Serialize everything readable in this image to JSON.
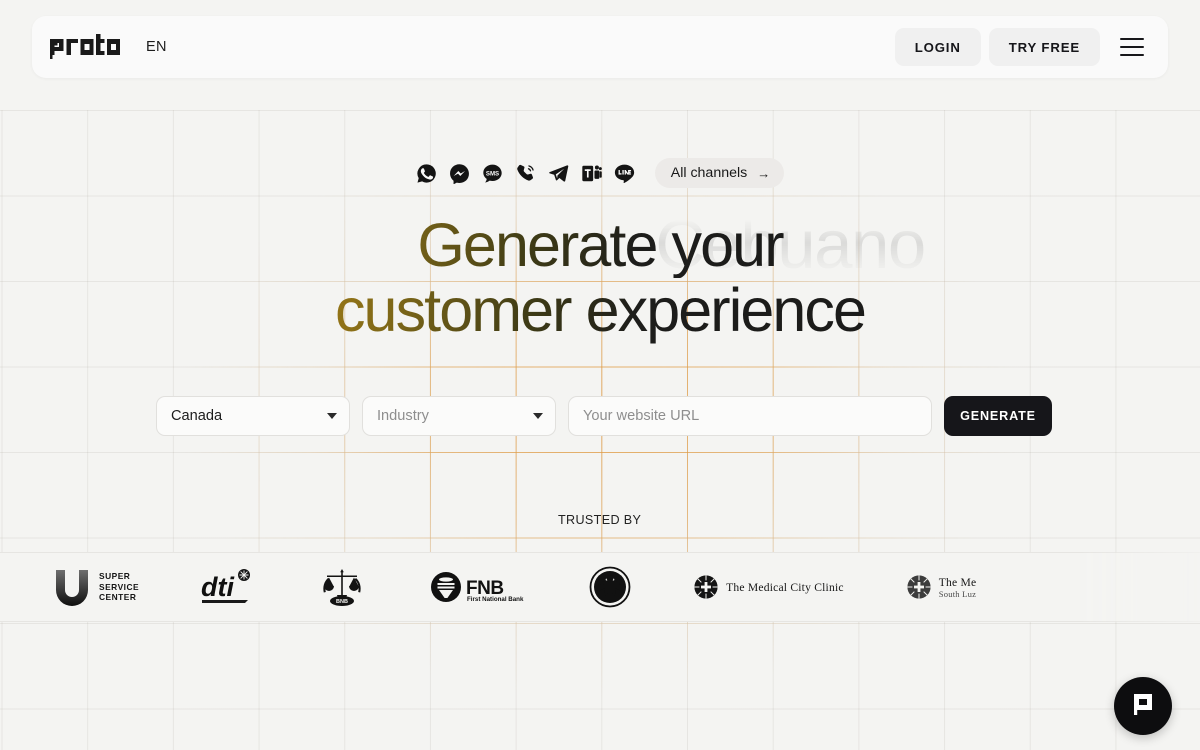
{
  "header": {
    "logo_text": "proto",
    "logo_icon": "proto-wordmark",
    "language": "EN",
    "login_label": "LOGIN",
    "try_free_label": "TRY FREE",
    "menu_icon": "hamburger-menu-icon"
  },
  "channels": {
    "items": [
      {
        "name": "whatsapp-icon",
        "title": "WhatsApp"
      },
      {
        "name": "messenger-icon",
        "title": "Messenger"
      },
      {
        "name": "sms-icon",
        "title": "SMS"
      },
      {
        "name": "voice-icon",
        "title": "Voice"
      },
      {
        "name": "telegram-icon",
        "title": "Telegram"
      },
      {
        "name": "teams-icon",
        "title": "Microsoft Teams"
      },
      {
        "name": "line-icon",
        "title": "LINE"
      }
    ],
    "all_channels_label": "All channels",
    "all_channels_arrow": "→"
  },
  "hero": {
    "ghost_text": "Cebuano",
    "line1": "Generate your",
    "line2": "customer experience",
    "gradient_start": "#efa40f",
    "gradient_end": "#181818"
  },
  "form": {
    "country_value": "Canada",
    "industry_placeholder": "Industry",
    "url_placeholder": "Your website URL",
    "generate_label": "GENERATE"
  },
  "trusted": {
    "label": "TRUSTED BY",
    "logos": [
      {
        "name": "super-service-center-logo",
        "mark": "U",
        "line1": "SUPER",
        "line2": "SERVICE",
        "line3": "CENTER"
      },
      {
        "name": "dti-logo",
        "mark": "dti"
      },
      {
        "name": "bnb-scales-logo",
        "mark": "BNB"
      },
      {
        "name": "fnb-logo",
        "mark": "FNB",
        "sub": "First National Bank"
      },
      {
        "name": "eagle-emblem-logo",
        "mark": "eagle"
      },
      {
        "name": "medical-city-clinic-logo",
        "mark": "T",
        "text": "he ",
        "words": "M EDICAL C ITY C LINIC",
        "full": "The Medical City Clinic"
      },
      {
        "name": "medical-city-south-luzon-logo",
        "full": "The Me",
        "sub": "South Luz"
      }
    ]
  },
  "chat": {
    "launcher_icon": "proto-chat-icon",
    "launcher_label": "Open chat"
  },
  "theme": {
    "page_bg": "#f4f4f2",
    "grid_accent": "#e2912a",
    "dark": "#16161a"
  }
}
